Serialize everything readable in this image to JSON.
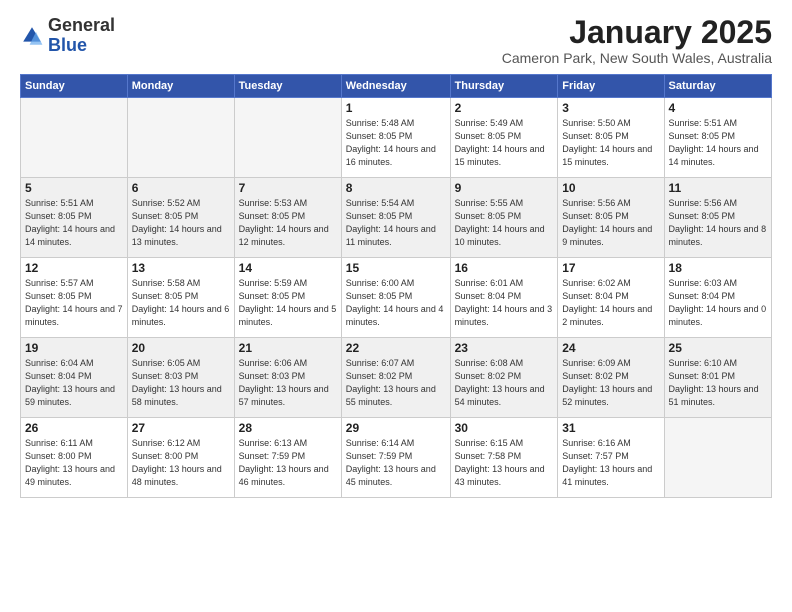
{
  "logo": {
    "general": "General",
    "blue": "Blue"
  },
  "header": {
    "month": "January 2025",
    "subtitle": "Cameron Park, New South Wales, Australia"
  },
  "weekdays": [
    "Sunday",
    "Monday",
    "Tuesday",
    "Wednesday",
    "Thursday",
    "Friday",
    "Saturday"
  ],
  "weeks": [
    [
      {
        "day": "",
        "info": ""
      },
      {
        "day": "",
        "info": ""
      },
      {
        "day": "",
        "info": ""
      },
      {
        "day": "1",
        "info": "Sunrise: 5:48 AM\nSunset: 8:05 PM\nDaylight: 14 hours\nand 16 minutes."
      },
      {
        "day": "2",
        "info": "Sunrise: 5:49 AM\nSunset: 8:05 PM\nDaylight: 14 hours\nand 15 minutes."
      },
      {
        "day": "3",
        "info": "Sunrise: 5:50 AM\nSunset: 8:05 PM\nDaylight: 14 hours\nand 15 minutes."
      },
      {
        "day": "4",
        "info": "Sunrise: 5:51 AM\nSunset: 8:05 PM\nDaylight: 14 hours\nand 14 minutes."
      }
    ],
    [
      {
        "day": "5",
        "info": "Sunrise: 5:51 AM\nSunset: 8:05 PM\nDaylight: 14 hours\nand 14 minutes."
      },
      {
        "day": "6",
        "info": "Sunrise: 5:52 AM\nSunset: 8:05 PM\nDaylight: 14 hours\nand 13 minutes."
      },
      {
        "day": "7",
        "info": "Sunrise: 5:53 AM\nSunset: 8:05 PM\nDaylight: 14 hours\nand 12 minutes."
      },
      {
        "day": "8",
        "info": "Sunrise: 5:54 AM\nSunset: 8:05 PM\nDaylight: 14 hours\nand 11 minutes."
      },
      {
        "day": "9",
        "info": "Sunrise: 5:55 AM\nSunset: 8:05 PM\nDaylight: 14 hours\nand 10 minutes."
      },
      {
        "day": "10",
        "info": "Sunrise: 5:56 AM\nSunset: 8:05 PM\nDaylight: 14 hours\nand 9 minutes."
      },
      {
        "day": "11",
        "info": "Sunrise: 5:56 AM\nSunset: 8:05 PM\nDaylight: 14 hours\nand 8 minutes."
      }
    ],
    [
      {
        "day": "12",
        "info": "Sunrise: 5:57 AM\nSunset: 8:05 PM\nDaylight: 14 hours\nand 7 minutes."
      },
      {
        "day": "13",
        "info": "Sunrise: 5:58 AM\nSunset: 8:05 PM\nDaylight: 14 hours\nand 6 minutes."
      },
      {
        "day": "14",
        "info": "Sunrise: 5:59 AM\nSunset: 8:05 PM\nDaylight: 14 hours\nand 5 minutes."
      },
      {
        "day": "15",
        "info": "Sunrise: 6:00 AM\nSunset: 8:05 PM\nDaylight: 14 hours\nand 4 minutes."
      },
      {
        "day": "16",
        "info": "Sunrise: 6:01 AM\nSunset: 8:04 PM\nDaylight: 14 hours\nand 3 minutes."
      },
      {
        "day": "17",
        "info": "Sunrise: 6:02 AM\nSunset: 8:04 PM\nDaylight: 14 hours\nand 2 minutes."
      },
      {
        "day": "18",
        "info": "Sunrise: 6:03 AM\nSunset: 8:04 PM\nDaylight: 14 hours\nand 0 minutes."
      }
    ],
    [
      {
        "day": "19",
        "info": "Sunrise: 6:04 AM\nSunset: 8:04 PM\nDaylight: 13 hours\nand 59 minutes."
      },
      {
        "day": "20",
        "info": "Sunrise: 6:05 AM\nSunset: 8:03 PM\nDaylight: 13 hours\nand 58 minutes."
      },
      {
        "day": "21",
        "info": "Sunrise: 6:06 AM\nSunset: 8:03 PM\nDaylight: 13 hours\nand 57 minutes."
      },
      {
        "day": "22",
        "info": "Sunrise: 6:07 AM\nSunset: 8:02 PM\nDaylight: 13 hours\nand 55 minutes."
      },
      {
        "day": "23",
        "info": "Sunrise: 6:08 AM\nSunset: 8:02 PM\nDaylight: 13 hours\nand 54 minutes."
      },
      {
        "day": "24",
        "info": "Sunrise: 6:09 AM\nSunset: 8:02 PM\nDaylight: 13 hours\nand 52 minutes."
      },
      {
        "day": "25",
        "info": "Sunrise: 6:10 AM\nSunset: 8:01 PM\nDaylight: 13 hours\nand 51 minutes."
      }
    ],
    [
      {
        "day": "26",
        "info": "Sunrise: 6:11 AM\nSunset: 8:00 PM\nDaylight: 13 hours\nand 49 minutes."
      },
      {
        "day": "27",
        "info": "Sunrise: 6:12 AM\nSunset: 8:00 PM\nDaylight: 13 hours\nand 48 minutes."
      },
      {
        "day": "28",
        "info": "Sunrise: 6:13 AM\nSunset: 7:59 PM\nDaylight: 13 hours\nand 46 minutes."
      },
      {
        "day": "29",
        "info": "Sunrise: 6:14 AM\nSunset: 7:59 PM\nDaylight: 13 hours\nand 45 minutes."
      },
      {
        "day": "30",
        "info": "Sunrise: 6:15 AM\nSunset: 7:58 PM\nDaylight: 13 hours\nand 43 minutes."
      },
      {
        "day": "31",
        "info": "Sunrise: 6:16 AM\nSunset: 7:57 PM\nDaylight: 13 hours\nand 41 minutes."
      },
      {
        "day": "",
        "info": ""
      }
    ]
  ]
}
